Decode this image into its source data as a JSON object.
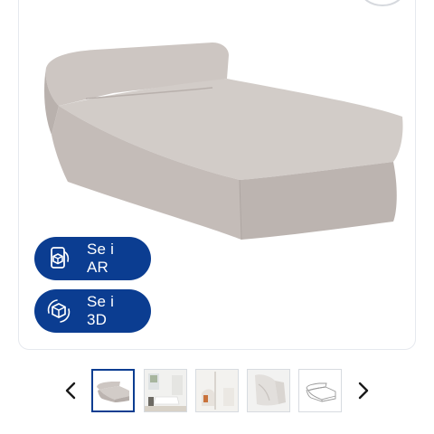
{
  "gallery": {
    "ar_button": {
      "label": "Se i AR",
      "icon": "ar-phone-cube-icon"
    },
    "view3d_button": {
      "label": "Se i 3D",
      "icon": "cube-rotate-icon"
    },
    "thumbnails": [
      {
        "name": "thumbnail-beanbag-lounger",
        "active": true
      },
      {
        "name": "thumbnail-living-room",
        "active": false
      },
      {
        "name": "thumbnail-interior-detail",
        "active": false
      },
      {
        "name": "thumbnail-corner-detail",
        "active": false
      },
      {
        "name": "thumbnail-dimension-sketch",
        "active": false
      }
    ],
    "prev_icon": "chevron-left-icon",
    "next_icon": "chevron-right-icon"
  },
  "colors": {
    "brand_blue": "#0b3d91",
    "fabric_grey": "#c7c0bc",
    "card_border": "#e6e9ee"
  }
}
